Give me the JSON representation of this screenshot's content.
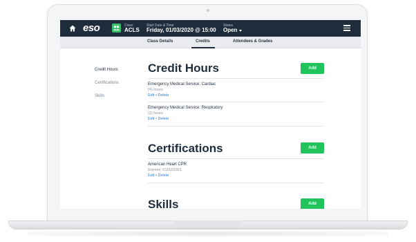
{
  "topbar": {
    "logo": "eso",
    "class_label": "Class",
    "class_value": "ACLS",
    "date_label": "Start Date & Time",
    "date_value": "Friday, 01/03/2020 @ 15:00",
    "status_label": "Status",
    "status_value": "Open"
  },
  "tabs": [
    {
      "label": "Class Details"
    },
    {
      "label": "Credits"
    },
    {
      "label": "Attendees & Grades"
    }
  ],
  "sidenav": [
    {
      "label": "Credit Hours"
    },
    {
      "label": "Certifications"
    },
    {
      "label": "Skills"
    }
  ],
  "sections": {
    "credit_hours": {
      "title": "Credit Hours",
      "add_label": "Add",
      "items": [
        {
          "title": "Emergency Medical Service: Cardiac",
          "sub": "(4) hours",
          "edit": "Edit",
          "sep": "•",
          "delete": "Delete"
        },
        {
          "title": "Emergency Medical Service: Respiratory",
          "sub": "(2) hours",
          "edit": "Edit",
          "sep": "•",
          "delete": "Delete"
        }
      ]
    },
    "certifications": {
      "title": "Certifications",
      "add_label": "Add",
      "items": [
        {
          "title": "American Heart CPR",
          "sub": "Expires: 01/02/2021",
          "edit": "Edit",
          "sep": "•",
          "delete": "Delete"
        }
      ]
    },
    "skills": {
      "title": "Skills",
      "add_label": "Add"
    }
  },
  "colors": {
    "navbar": "#1e2c3c",
    "accent_green": "#21c45c",
    "link_blue": "#2d7fd3"
  }
}
